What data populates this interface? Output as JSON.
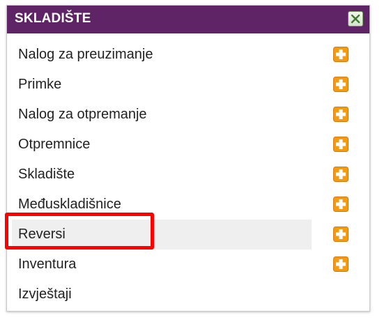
{
  "panel": {
    "title": "SKLADIŠTE",
    "close_icon": "close-icon"
  },
  "menu": {
    "items": [
      {
        "label": "Nalog za preuzimanje",
        "has_add": true
      },
      {
        "label": "Primke",
        "has_add": true
      },
      {
        "label": "Nalog za otpremanje",
        "has_add": true
      },
      {
        "label": "Otpremnice",
        "has_add": true
      },
      {
        "label": "Skladište",
        "has_add": true
      },
      {
        "label": "Međuskladišnice",
        "has_add": true
      },
      {
        "label": "Reversi",
        "has_add": true,
        "hovered": true,
        "highlighted": true
      },
      {
        "label": "Inventura",
        "has_add": true
      },
      {
        "label": "Izvještaji",
        "has_add": false
      }
    ],
    "add_icon": "plus-icon"
  },
  "colors": {
    "header_bg": "#5f2466",
    "add_icon": "#f39c12",
    "highlight": "#ff0000",
    "hover_bg": "#efefef"
  }
}
